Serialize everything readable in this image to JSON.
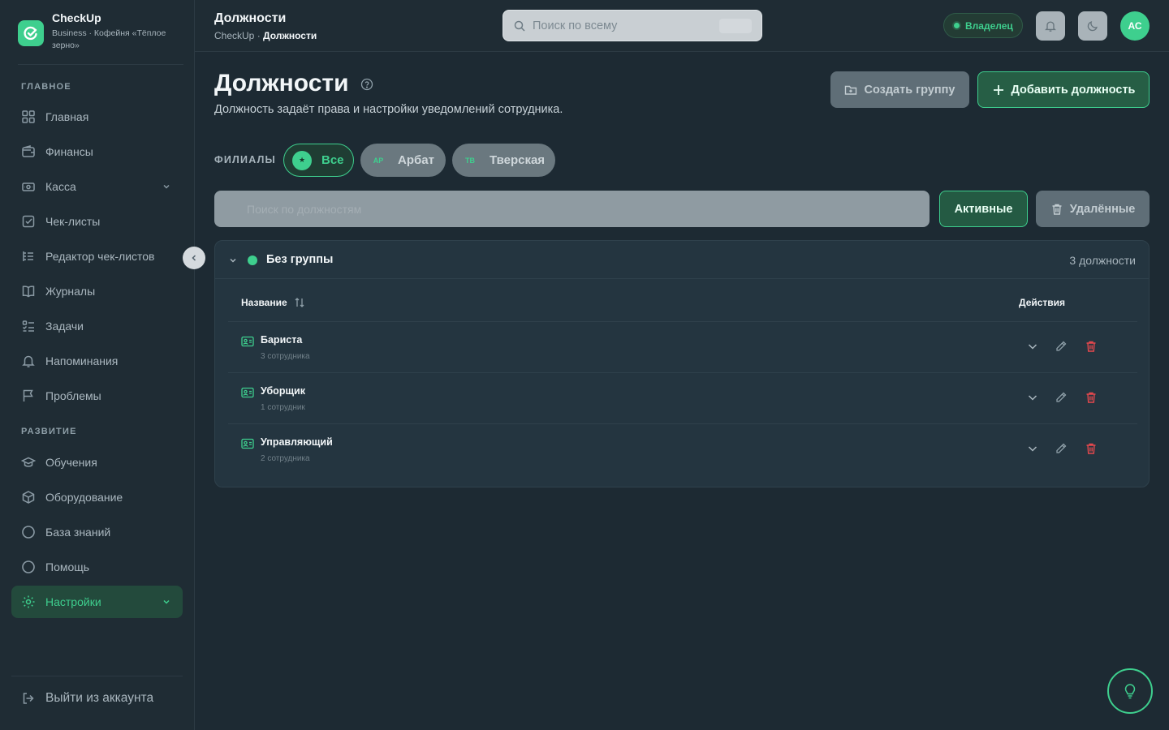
{
  "brand": {
    "name": "CheckUp",
    "subtitle": "Business · Кофейня «Тёплое зерно»",
    "accent": "#3ecf8e"
  },
  "sidebar": {
    "sections": [
      {
        "title": "ГЛАВНОЕ"
      },
      {
        "title": "РАЗВИТИЕ"
      }
    ],
    "main_items": [
      {
        "label": "Главная",
        "icon": "grid-icon"
      },
      {
        "label": "Финансы",
        "icon": "wallet-icon"
      },
      {
        "label": "Касса",
        "icon": "cash-register-icon",
        "expandable": true
      },
      {
        "label": "Чек-листы",
        "icon": "checklist-icon"
      },
      {
        "label": "Редактор чек-листов",
        "icon": "list-editor-icon"
      },
      {
        "label": "Журналы",
        "icon": "book-icon"
      },
      {
        "label": "Задачи",
        "icon": "tasks-icon"
      },
      {
        "label": "Напоминания",
        "icon": "bell-icon"
      },
      {
        "label": "Проблемы",
        "icon": "flag-icon"
      }
    ],
    "dev_items": [
      {
        "label": "Обучения",
        "icon": "graduation-cap-icon"
      },
      {
        "label": "Оборудование",
        "icon": "box-icon"
      },
      {
        "label": "База знаний",
        "icon": "circle-icon"
      },
      {
        "label": "Помощь",
        "icon": "circle-icon"
      },
      {
        "label": "Настройки",
        "icon": "gear-icon",
        "active": true,
        "expandable": true
      }
    ],
    "logout_label": "Выйти из аккаунта"
  },
  "header": {
    "title": "Должности",
    "breadcrumb_root": "CheckUp",
    "breadcrumb_sep": " · ",
    "breadcrumb_current": "Должности",
    "search_placeholder": "Поиск по всему",
    "role_label": "Владелец",
    "avatar_initials": "АС"
  },
  "page": {
    "title": "Должности",
    "description": "Должность задаёт права и настройки уведомлений сотрудника.",
    "create_group_label": "Создать группу",
    "add_position_label": "Добавить должность"
  },
  "branches": {
    "label": "ФИЛИАЛЫ",
    "chips": [
      {
        "badge": "★",
        "label": "Все",
        "active": true
      },
      {
        "badge": "АР",
        "label": "Арбат",
        "active": false
      },
      {
        "badge": "ТВ",
        "label": "Тверская",
        "active": false
      }
    ]
  },
  "filters": {
    "search_placeholder": "Поиск по должностям",
    "active_label": "Активные",
    "deleted_label": "Удалённые"
  },
  "group": {
    "name": "Без группы",
    "count": "3 должности",
    "columns": {
      "name": "Название",
      "actions": "Действия"
    },
    "rows": [
      {
        "name": "Бариста",
        "employees": "3 сотрудника"
      },
      {
        "name": "Уборщик",
        "employees": "1 сотрудник"
      },
      {
        "name": "Управляющий",
        "employees": "2 сотрудника"
      }
    ]
  }
}
